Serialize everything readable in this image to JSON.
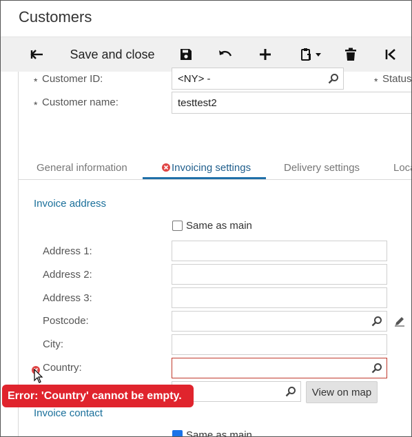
{
  "window": {
    "title": "Customers"
  },
  "toolbar": {
    "back_icon": "back-arrow-icon",
    "save_close_label": "Save and close",
    "save_icon": "floppy-disk-icon",
    "undo_icon": "undo-icon",
    "add_icon": "plus-icon",
    "clipboard_icon": "clipboard-icon",
    "delete_icon": "trash-icon",
    "first_icon": "first-record-icon"
  },
  "header_fields": {
    "customer_id_label": "Customer ID:",
    "customer_id_value": "<NY> -",
    "status_label": "Status",
    "customer_name_label": "Customer name:",
    "customer_name_value": "testtest2",
    "required_marker": "*"
  },
  "tabs": [
    {
      "label": "General information"
    },
    {
      "label": "Invoicing settings",
      "active": true,
      "has_error": true
    },
    {
      "label": "Delivery settings"
    },
    {
      "label": "Loca"
    }
  ],
  "invoice_address": {
    "section_title": "Invoice address",
    "same_as_main_label": "Same as main",
    "same_as_main_checked": false,
    "address1_label": "Address 1:",
    "address1_value": "",
    "address2_label": "Address 2:",
    "address2_value": "",
    "address3_label": "Address 3:",
    "address3_value": "",
    "postcode_label": "Postcode:",
    "postcode_value": "",
    "city_label": "City:",
    "city_value": "",
    "country_label": "Country:",
    "country_value": "",
    "view_on_map_label": "View on map"
  },
  "error_tooltip": {
    "text": "Error: 'Country' cannot be empty."
  },
  "invoice_contact": {
    "section_title": "Invoice contact",
    "same_as_main_label": "Same as main",
    "same_as_main_checked": true
  },
  "colors": {
    "accent": "#1f6fa8",
    "error": "#e0242d",
    "link": "#1a6f9a"
  }
}
